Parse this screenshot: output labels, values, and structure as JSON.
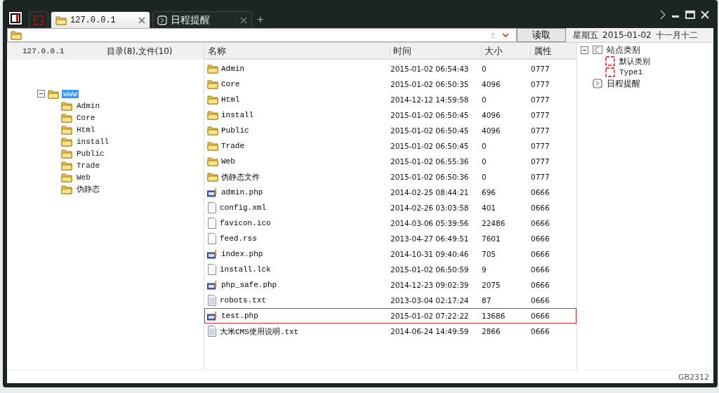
{
  "tabs": [
    {
      "kind": "blank",
      "selected": false
    },
    {
      "kind": "folder",
      "label": "127.0.0.1",
      "selected": true
    },
    {
      "kind": "schedule",
      "label": "日程提醒",
      "selected": false
    }
  ],
  "new_tab": "+",
  "address_bar": {
    "button": "读取"
  },
  "date_bar": {
    "weekday": "星期五",
    "date": "2015-01-02",
    "lunar": "十一月十二"
  },
  "tree_header": {
    "host": "127.0.0.1",
    "summary": "目录(8),文件(10)"
  },
  "folder_tree": [
    {
      "label": "www",
      "selected": true,
      "expanded": true,
      "children": [
        {
          "label": "Admin"
        },
        {
          "label": "Core"
        },
        {
          "label": "Html"
        },
        {
          "label": "install"
        },
        {
          "label": "Public"
        },
        {
          "label": "Trade"
        },
        {
          "label": "Web"
        },
        {
          "label": "伪静态"
        }
      ]
    }
  ],
  "table": {
    "columns": [
      "名称",
      "时间",
      "大小",
      "属性"
    ],
    "rows": [
      {
        "kind": "folder",
        "name": "Admin",
        "time": "2015-01-02 06:54:43",
        "size": "0",
        "mode": "0777",
        "marked": false
      },
      {
        "kind": "folder",
        "name": "Core",
        "time": "2015-01-02 06:50:35",
        "size": "4096",
        "mode": "0777",
        "marked": false
      },
      {
        "kind": "folder",
        "name": "Html",
        "time": "2014-12-12 14:59:58",
        "size": "0",
        "mode": "0777",
        "marked": false
      },
      {
        "kind": "folder",
        "name": "install",
        "time": "2015-01-02 06:50:45",
        "size": "4096",
        "mode": "0777",
        "marked": false
      },
      {
        "kind": "folder",
        "name": "Public",
        "time": "2015-01-02 06:50:45",
        "size": "4096",
        "mode": "0777",
        "marked": false
      },
      {
        "kind": "folder",
        "name": "Trade",
        "time": "2015-01-02 06:50:45",
        "size": "0",
        "mode": "0777",
        "marked": false
      },
      {
        "kind": "folder",
        "name": "Web",
        "time": "2015-01-02 06:55:36",
        "size": "0",
        "mode": "0777",
        "marked": false
      },
      {
        "kind": "folder",
        "name": "伪静态文件",
        "time": "2015-01-02 06:50:36",
        "size": "0",
        "mode": "0777",
        "marked": false
      },
      {
        "kind": "php",
        "name": "admin.php",
        "time": "2014-02-25 08:44:21",
        "size": "696",
        "mode": "0666",
        "marked": false
      },
      {
        "kind": "file",
        "name": "config.xml",
        "time": "2014-02-26 03:03:58",
        "size": "401",
        "mode": "0666",
        "marked": false
      },
      {
        "kind": "file",
        "name": "favicon.ico",
        "time": "2014-03-06 05:39:56",
        "size": "22486",
        "mode": "0666",
        "marked": false
      },
      {
        "kind": "file",
        "name": "feed.rss",
        "time": "2013-04-27 06:49:51",
        "size": "7601",
        "mode": "0666",
        "marked": false
      },
      {
        "kind": "php",
        "name": "index.php",
        "time": "2014-10-31 09:40:46",
        "size": "705",
        "mode": "0666",
        "marked": false
      },
      {
        "kind": "file",
        "name": "install.lck",
        "time": "2015-01-02 06:50:59",
        "size": "9",
        "mode": "0666",
        "marked": false
      },
      {
        "kind": "php",
        "name": "php_safe.php",
        "time": "2014-12-23 09:02:39",
        "size": "2075",
        "mode": "0666",
        "marked": false
      },
      {
        "kind": "text",
        "name": "robots.txt",
        "time": "2013-03-04 02:17:24",
        "size": "87",
        "mode": "0666",
        "marked": false
      },
      {
        "kind": "php",
        "name": "test.php",
        "time": "2015-01-02 07:22:22",
        "size": "13686",
        "mode": "0666",
        "marked": true
      },
      {
        "kind": "text",
        "name": "大米CMS使用说明.txt",
        "time": "2014-06-24 14:49:59",
        "size": "2866",
        "mode": "0666",
        "marked": false
      }
    ]
  },
  "category_tree": [
    {
      "kind": "category",
      "label": "站点类别",
      "expanded": true,
      "children": [
        {
          "label": "默认类别"
        },
        {
          "label": "Type1"
        }
      ]
    },
    {
      "kind": "schedule",
      "label": "日程提醒"
    }
  ],
  "status_bar": {
    "encoding": "GB2312"
  }
}
